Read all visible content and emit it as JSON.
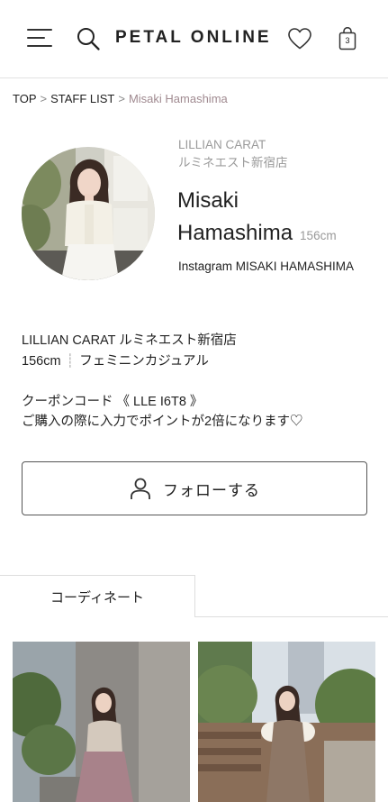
{
  "header": {
    "logo": "PETAL ONLINE",
    "cart_count": "3"
  },
  "breadcrumb": {
    "items": [
      "TOP",
      "STAFF LIST"
    ],
    "separator": ">",
    "current": "Misaki Hamashima"
  },
  "profile": {
    "shop_line1": "LILLIAN CARAT",
    "shop_line2": "ルミネエスト新宿店",
    "name_line1": "Misaki",
    "name_line2": "Hamashima",
    "height": "156cm",
    "instagram": "Instagram MISAKI HAMASHIMA"
  },
  "bio": {
    "line1": "LILLIAN CARAT ルミネエスト新宿店",
    "height": "156cm",
    "divider": "┊",
    "style": "フェミニンカジュアル",
    "coupon": "クーポンコード 《 LLE I6T8 》",
    "coupon_note": "ご購入の際に入力でポイントが2倍になります♡"
  },
  "follow": {
    "label": "フォローする"
  },
  "tabs": [
    {
      "label": "コーディネート",
      "active": true
    }
  ],
  "colors": {
    "text": "#222222",
    "muted": "#9a9a9a",
    "breadcrumb_current": "#a08a90",
    "border": "#dddddd"
  },
  "icons": [
    "hamburger-menu-icon",
    "search-icon",
    "heart-icon",
    "shopping-bag-icon",
    "person-icon"
  ]
}
